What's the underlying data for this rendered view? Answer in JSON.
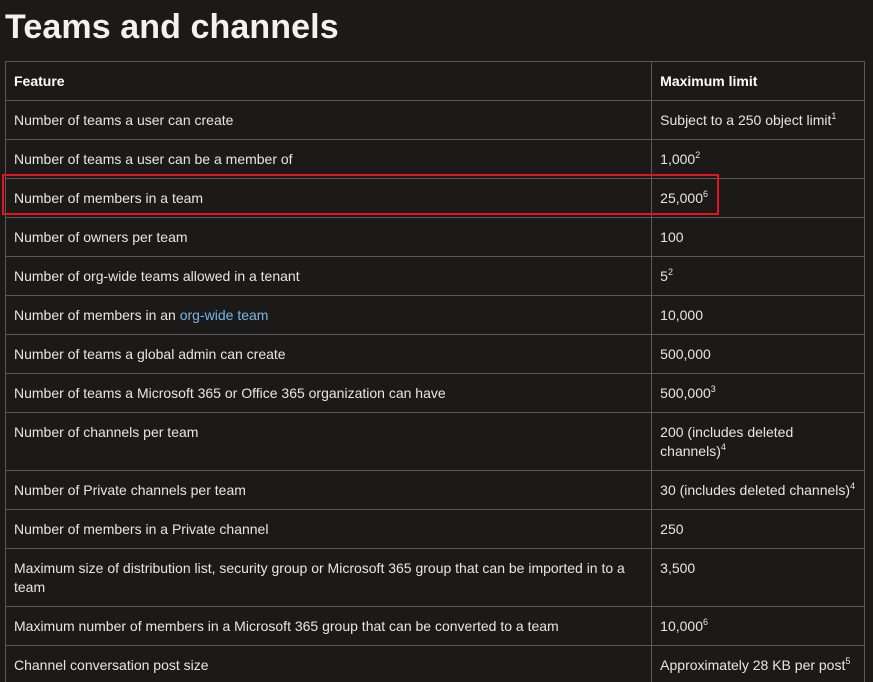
{
  "title": "Teams and channels",
  "table": {
    "headers": {
      "feature": "Feature",
      "limit": "Maximum limit"
    },
    "rows": [
      {
        "feature": "Number of teams a user can create",
        "limit": "Subject to a 250 object limit",
        "sup": "1"
      },
      {
        "feature": "Number of teams a user can be a member of",
        "limit": "1,000",
        "sup": "2"
      },
      {
        "feature": "Number of members in a team",
        "limit": "25,000",
        "sup": "6",
        "highlighted": true
      },
      {
        "feature": "Number of owners per team",
        "limit": "100",
        "sup": ""
      },
      {
        "feature": "Number of org-wide teams allowed in a tenant",
        "limit": "5",
        "sup": "2"
      },
      {
        "feature_prefix": "Number of members in an ",
        "feature_link": "org-wide team",
        "limit": "10,000",
        "sup": ""
      },
      {
        "feature": "Number of teams a global admin can create",
        "limit": "500,000",
        "sup": ""
      },
      {
        "feature": "Number of teams a Microsoft 365 or Office 365 organization can have",
        "limit": "500,000",
        "sup": "3"
      },
      {
        "feature": "Number of channels per team",
        "limit": "200 (includes deleted channels)",
        "sup": "4"
      },
      {
        "feature": "Number of Private channels per team",
        "limit": "30 (includes deleted channels)",
        "sup": "4"
      },
      {
        "feature": "Number of members in a Private channel",
        "limit": "250",
        "sup": ""
      },
      {
        "feature": "Maximum size of distribution list, security group or Microsoft 365 group that can be imported in to a team",
        "limit": "3,500",
        "sup": ""
      },
      {
        "feature": "Maximum number of members in a Microsoft 365 group that can be converted to a team",
        "limit": "10,000",
        "sup": "6"
      },
      {
        "feature": "Channel conversation post size",
        "limit": "Approximately 28 KB per post",
        "sup": "5"
      }
    ]
  },
  "colors": {
    "background": "#1b1a19",
    "border": "#5c5b5a",
    "link": "#75b6e7",
    "highlight": "#e81123"
  }
}
